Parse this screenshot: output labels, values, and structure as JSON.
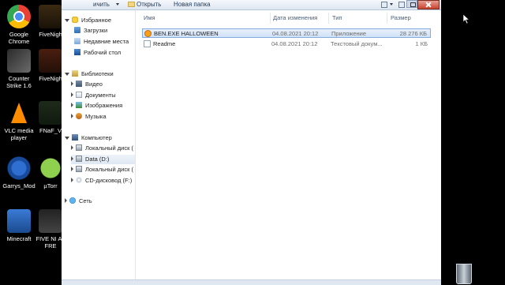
{
  "desktop": {
    "icons": [
      {
        "name": "Google Chrome",
        "kind": "chrome"
      },
      {
        "name": "FiveNigh",
        "kind": "fnaf"
      },
      {
        "name": "Counter Strike 1.6",
        "kind": "cs"
      },
      {
        "name": "FiveNigh",
        "kind": "fnaf2"
      },
      {
        "name": "VLC media player",
        "kind": "vlc"
      },
      {
        "name": "FNaF_V",
        "kind": "fnafv"
      },
      {
        "name": "Garrys_Mod",
        "kind": "gmod"
      },
      {
        "name": "µTorr",
        "kind": "utorrent"
      },
      {
        "name": "Minecraft",
        "kind": "minecraft"
      },
      {
        "name": "FIVE NI AT FRE",
        "kind": "fivenights"
      }
    ]
  },
  "toolbar": {
    "items": [
      "ичить",
      "Открыть",
      "Новая папка"
    ]
  },
  "nav": {
    "favorites": {
      "label": "Избранное",
      "items": [
        "Загрузки",
        "Недавние места",
        "Рабочий стол"
      ]
    },
    "libraries": {
      "label": "Библиотеки",
      "items": [
        "Видео",
        "Документы",
        "Изображения",
        "Музыка"
      ]
    },
    "computer": {
      "label": "Компьютер",
      "items": [
        "Локальный диск (",
        "Data (D:)",
        "Локальный диск (",
        "CD-дисковод (F:)"
      ]
    },
    "network": {
      "label": "Сеть"
    }
  },
  "columns": {
    "name": "Имя",
    "date": "Дата изменения",
    "type": "Тип",
    "size": "Размер"
  },
  "files": [
    {
      "name": "BEN.EXE HALLOWEEN",
      "date": "04.08.2021 20:12",
      "type": "Приложение",
      "size": "28 276 КБ",
      "kind": "app",
      "selected": true
    },
    {
      "name": "Readme",
      "date": "04.08.2021 20:12",
      "type": "Текстовый докум...",
      "size": "1 КБ",
      "kind": "txt",
      "selected": false
    }
  ]
}
